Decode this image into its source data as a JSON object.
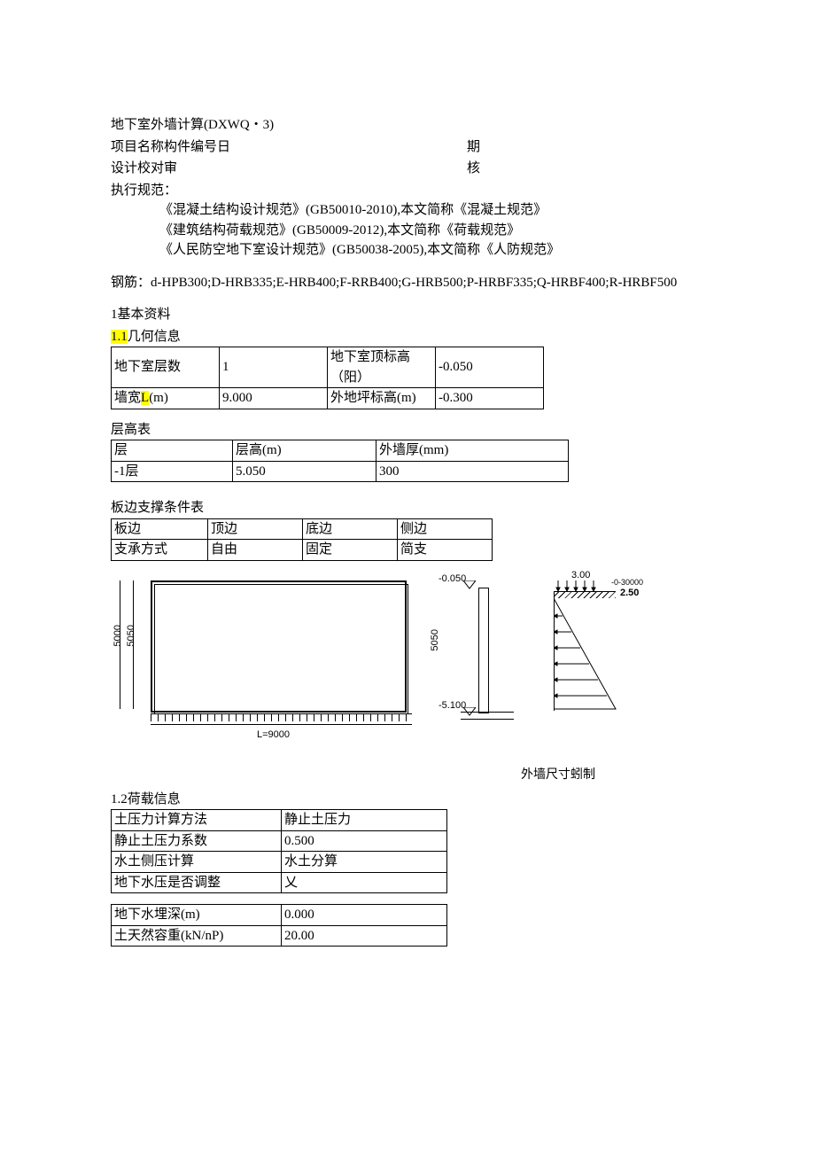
{
  "title": "地下室外墙计算(DXWQ・3)",
  "header": {
    "line2_left": "项目名称构件编号日",
    "line2_right": "期",
    "line3_left": "设计校对审",
    "line3_right": "核"
  },
  "regs_title": "执行规范：",
  "regs": [
    "《混凝土结构设计规范》(GB50010-2010),本文简称《混凝土规范》",
    "《建筑结构荷载规范》(GB50009-2012),本文简称《荷载规范》",
    "《人民防空地下室设计规范》(GB50038-2005),本文简称《人防规范》"
  ],
  "rebar_note": "钢筋：d-HPB300;D-HRB335;E-HRB400;F-RRB400;G-HRB500;P-HRBF335;Q-HRBF400;R-HRBF500",
  "sec1": "1基本资料",
  "sec11_prefix": "1.1",
  "sec11": "几何信息",
  "geom": {
    "r1c1": "地下室层数",
    "r1c2": "1",
    "r1c3": "地下室顶标高（阳）",
    "r1c4": "-0.050",
    "r2c1_a": "墙宽",
    "r2c1_b": "L",
    "r2c1_c": "(m)",
    "r2c2": "9.000",
    "r2c3": "外地坪标高(m)",
    "r2c4": "-0.300"
  },
  "floor_title": "层高表",
  "floor": {
    "h1": "层",
    "h2": "层高(m)",
    "h3": "外墙厚(mm)",
    "r1": "-1层",
    "r2": "5.050",
    "r3": "300"
  },
  "edge_title": "板边支撑条件表",
  "edge": {
    "h1": "板边",
    "h2": "顶边",
    "h3": "底边",
    "h4": "侧边",
    "r1": "支承方式",
    "r2": "自由",
    "r3": "固定",
    "r4": "简支"
  },
  "diagram": {
    "caption": "外墙尺寸蚓制",
    "elev_top": "-0.050",
    "elev_bot": "-5.100",
    "dim_5000": "5000",
    "dim_L": "L=9000",
    "dim_5050": "5050",
    "top_right_a": "3.00",
    "top_right_b": "-0-30000",
    "top_right_c": "2.50"
  },
  "sec12": "1.2荷载信息",
  "load1": {
    "r1c1": "土压力计算方法",
    "r1c2": "静止土压力",
    "r2c1": "静止土压力系数",
    "r2c2": "0.500",
    "r3c1": "水土侧压计算",
    "r3c2": "水土分算",
    "r4c1": "地下水压是否调整",
    "r4c2": "乂"
  },
  "load2": {
    "r1c1": "地下水埋深(m)",
    "r1c2": "0.000",
    "r2c1": "土天然容重(kN/nP)",
    "r2c2": "20.00"
  }
}
